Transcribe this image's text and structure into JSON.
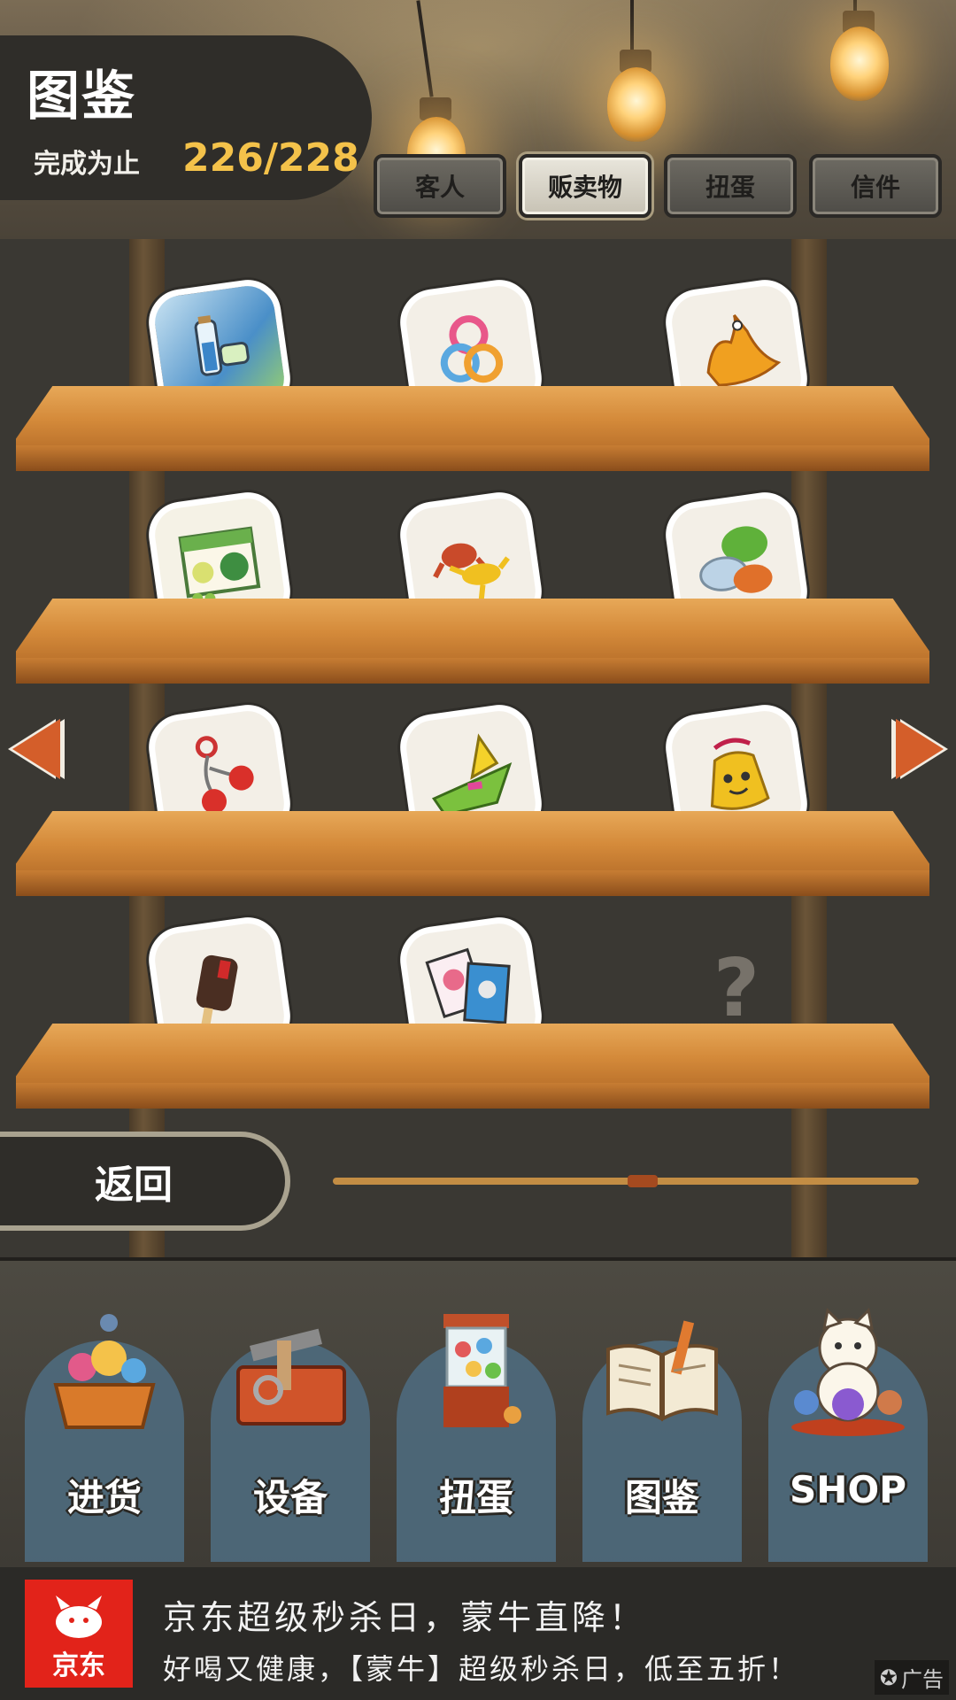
{
  "header": {
    "title": "图鉴",
    "progress_label": "完成为止",
    "progress_value": "226/228"
  },
  "tabs": [
    {
      "label": "客人",
      "active": false
    },
    {
      "label": "贩卖物",
      "active": true
    },
    {
      "label": "扭蛋",
      "active": false
    },
    {
      "label": "信件",
      "active": false
    }
  ],
  "shelf": {
    "items": [
      {
        "icon": "bottles-icon"
      },
      {
        "icon": "rings-icon"
      },
      {
        "icon": "bird-toy-icon"
      },
      {
        "icon": "apple-candy-box-icon"
      },
      {
        "icon": "frog-crayfish-icon"
      },
      {
        "icon": "marbles-icon"
      },
      {
        "icon": "clacker-balls-icon"
      },
      {
        "icon": "paper-boat-icon"
      },
      {
        "icon": "lucky-bell-icon"
      },
      {
        "icon": "ice-pop-icon"
      },
      {
        "icon": "cards-icon"
      },
      {
        "icon": "unknown-item-icon",
        "label": "?"
      }
    ],
    "slider_position": 0.53
  },
  "back_button": {
    "label": "返回"
  },
  "nav": [
    {
      "label": "进货",
      "icon": "goods-basket-icon"
    },
    {
      "label": "设备",
      "icon": "toolbox-icon"
    },
    {
      "label": "扭蛋",
      "icon": "gacha-machine-icon"
    },
    {
      "label": "图鉴",
      "icon": "open-book-icon"
    },
    {
      "label": "SHOP",
      "icon": "lucky-cat-icon"
    }
  ],
  "ad": {
    "logo_text": "京东",
    "line1": "京东超级秒杀日，蒙牛直降！",
    "line2": "好喝又健康，【蒙牛】超级秒杀日，低至五折！",
    "badge": "广告"
  },
  "colors": {
    "accent_gold": "#f4c24a",
    "arrow_orange": "#d45e2a",
    "ad_red": "#e2231a"
  }
}
